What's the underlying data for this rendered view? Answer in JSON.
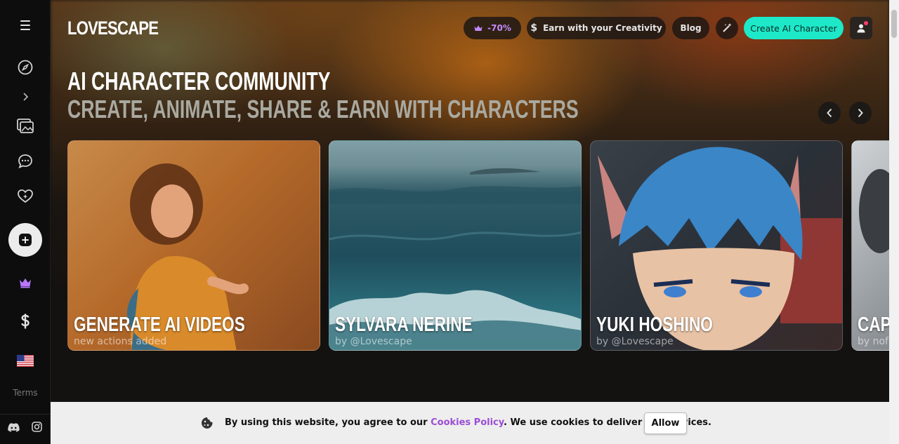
{
  "header": {
    "logo": "LOVESCAPE",
    "discount_label": "-70%",
    "earn_label": "Earn with your Creativity",
    "blog_label": "Blog",
    "create_label": "Create AI Character"
  },
  "hero": {
    "title": "AI CHARACTER COMMUNITY",
    "subtitle": "CREATE, ANIMATE, SHARE & EARN WITH CHARACTERS"
  },
  "cards": [
    {
      "title": "GENERATE AI VIDEOS",
      "subtitle": "new actions added"
    },
    {
      "title": "SYLVARA NERINE",
      "subtitle": "by @Lovescape"
    },
    {
      "title": "YUKI HOSHINO",
      "subtitle": "by @Lovescape"
    },
    {
      "title": "CAPT",
      "subtitle": "by nofa"
    }
  ],
  "sidebar": {
    "terms_label": "Terms"
  },
  "cookie": {
    "text_before": "By using this website, you agree to our ",
    "link_label": "Cookies Policy",
    "text_after": ". We use cookies to deliver our services.",
    "allow_label": "Allow"
  },
  "colors": {
    "accent": "#1de9c9",
    "premium": "#c28bff",
    "cookie_link": "#9b4dd6"
  }
}
